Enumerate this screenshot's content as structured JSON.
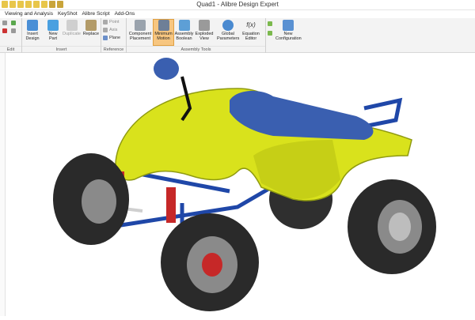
{
  "window": {
    "title": "Quad1 - Alibre Design Expert"
  },
  "menu": [
    "Viewing and Analysis",
    "KeyShot",
    "Alibre Script",
    "Add-Ons"
  ],
  "ribbon": {
    "groups": {
      "edit": "Edit",
      "insert": "Insert",
      "reference": "Reference",
      "assembly_tools": "Assembly Tools"
    },
    "insert_design": "Insert Design",
    "new_part": "New Part",
    "duplicate": "Duplicate",
    "replace": "Replace",
    "point": "Point",
    "axis": "Axis",
    "plane": "Plane",
    "component_placement": "Component Placement",
    "minimum_motion": "Minimum Motion",
    "assembly_boolean": "Assembly Boolean",
    "exploded_view": "Exploded View",
    "global_parameters": "Global Parameters",
    "equation_editor": "Equation Editor",
    "new_configuration": "New Configuration",
    "fx_glyph": "f(x)"
  },
  "colors": {
    "body": "#d9e21c",
    "seat": "#3a5fb0",
    "frame": "#1f47a8",
    "tire": "#2a2a2a",
    "accent": "#f7c680"
  }
}
